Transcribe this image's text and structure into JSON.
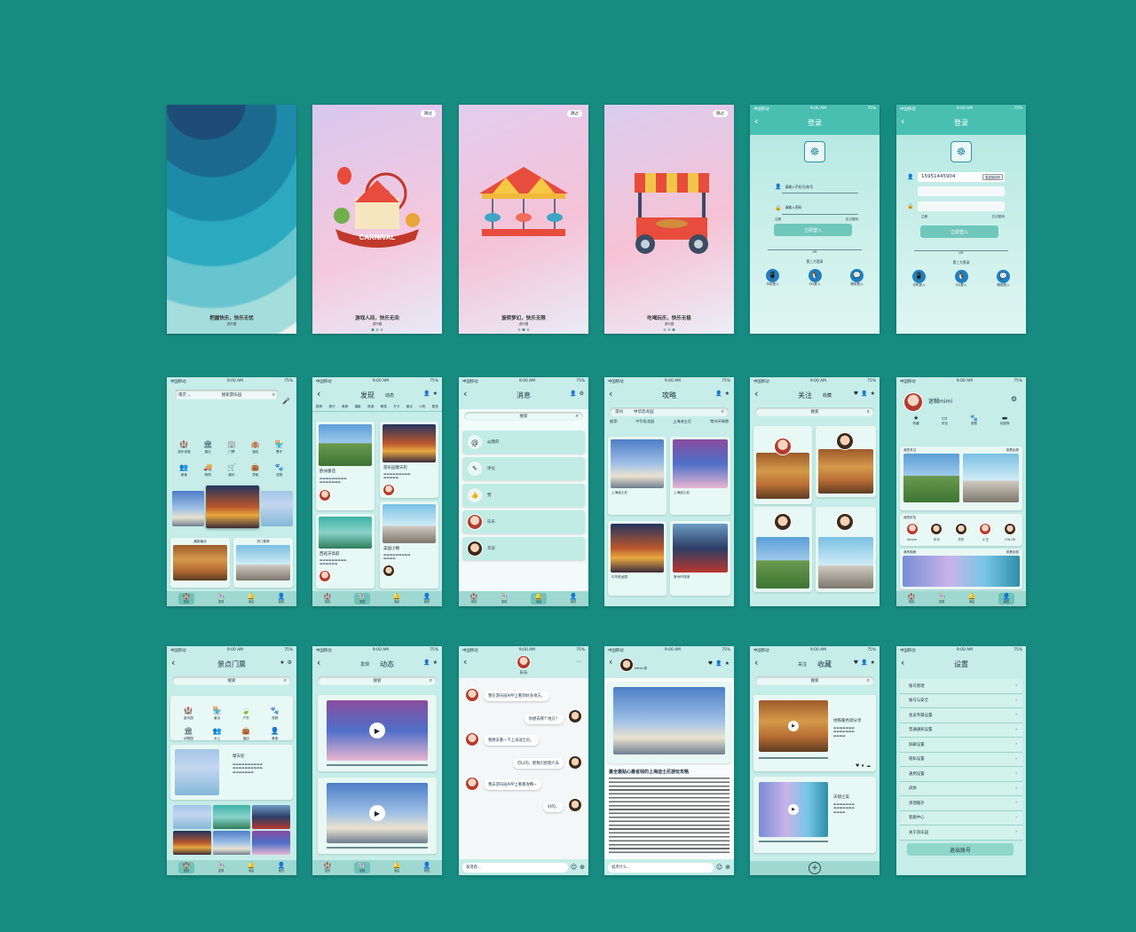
{
  "status": {
    "carrier": "中国移动",
    "time": "9:00 AM",
    "battery": "75%"
  },
  "splash": {
    "slogan": "把握快乐，快乐无忧",
    "brand": "游乐园"
  },
  "onboard": [
    {
      "skip": "跳过",
      "slogan": "游戏人间，快乐无间",
      "brand": "游乐园",
      "banner": "CARNIVAL"
    },
    {
      "skip": "跳过",
      "slogan": "旋转梦幻，快乐无限",
      "brand": "游乐园"
    },
    {
      "skip": "跳过",
      "slogan": "吃喝玩乐，快乐无极",
      "brand": "游乐园"
    }
  ],
  "login1": {
    "title": "登录",
    "phone_placeholder": "请输入手机号/账号",
    "password_placeholder": "请输入密码",
    "register": "注册",
    "forgot": "忘记密码",
    "submit": "立即登入",
    "or": "OR",
    "third": "第三方登录",
    "methods": [
      "手机登入",
      "QQ登入",
      "微信登入"
    ]
  },
  "login2": {
    "title": "登录",
    "phone_value": "15951445904",
    "send_code": "发送验证码",
    "register": "注册",
    "forgot": "忘记密码",
    "submit": "立即登入",
    "or": "OR",
    "third": "第三方登录",
    "methods": [
      "手机登入",
      "QQ登入",
      "微信登入"
    ]
  },
  "home": {
    "city": "南京",
    "search": "搜索游乐园",
    "icons": [
      "游乐设施",
      "景点",
      "门票",
      "酒店",
      "餐厅",
      "美食",
      "购物",
      "娱乐",
      "导航",
      "宠物"
    ],
    "cards": [
      "最新最优",
      "热门推荐"
    ],
    "tabs": [
      "首页",
      "发现",
      "消息",
      "我的"
    ]
  },
  "discover": {
    "title": "发现",
    "sub": "动态",
    "categories": [
      "推荐",
      "旅行",
      "美食",
      "摄影",
      "夜游",
      "萌宠",
      "打卡",
      "景点",
      "小吃",
      "更多"
    ],
    "posts": [
      "欧洲童话",
      "游乐园摩天轮",
      "西班牙高庭",
      "美国小镇"
    ]
  },
  "messages": {
    "title": "消息",
    "search": "搜索",
    "items": [
      "@我的",
      "评论",
      "赞",
      "乐乐",
      "华华"
    ]
  },
  "guide": {
    "title": "攻略",
    "city": "常州",
    "search": "中华恐龙园",
    "tabs": [
      "推荐",
      "中华恐龙园",
      "上海迪士尼",
      "常州环球港"
    ],
    "cards": [
      "上海迪士尼",
      "上海迪士尼",
      "中华恐龙园",
      "常州环球港"
    ]
  },
  "follow": {
    "title": "关注",
    "sub": "收藏",
    "search": "搜索"
  },
  "mine": {
    "name": "迷糊mimi",
    "stats": [
      "收藏",
      "评论",
      "宠物",
      "优惠券"
    ],
    "sec1": "我的关注",
    "more1": "查看全部",
    "sec2": "我的好友",
    "friends": [
      "Kelvin",
      "乐乐",
      "华华",
      "小王",
      "CHLOE"
    ],
    "sec3": "我的相册",
    "more3": "查看全部"
  },
  "tickets": {
    "title": "景点门票",
    "search": "搜索",
    "icons": [
      "游乐园",
      "景点",
      "户外",
      "宠物",
      "动物园",
      "水上",
      "酒店",
      "美食"
    ],
    "feature": "摩天轮"
  },
  "dynamic": {
    "title": "动态",
    "tab": "发现",
    "search": "搜索"
  },
  "chat": {
    "name": "乐乐",
    "messages": [
      "我在游乐园APP上看到好多地方。",
      "你想去哪个地方？",
      "我想去看一下上海迪士尼。",
      "可以的，那我们星期六去",
      "我去游乐园APP上看看攻略~",
      "好的。"
    ],
    "input": "发消息..."
  },
  "article": {
    "author": "kelvin李",
    "title": "最全最贴心最省钱的上海迪士尼游玩攻略",
    "comment": "说点什么..."
  },
  "favorites": {
    "title": "收藏",
    "tab": "关注",
    "search": "搜索",
    "items": [
      "地铁暖色调分享",
      "天镜之美"
    ]
  },
  "settings": {
    "title": "设置",
    "rows": [
      "账号管理",
      "账号与安全",
      "会员专属设置",
      "普通通知设置",
      "屏蔽设置",
      "隐私设置",
      "通用设置",
      "皮肤",
      "清理缓存",
      "客服中心",
      "关于游乐园"
    ],
    "logout": "退出账号"
  }
}
